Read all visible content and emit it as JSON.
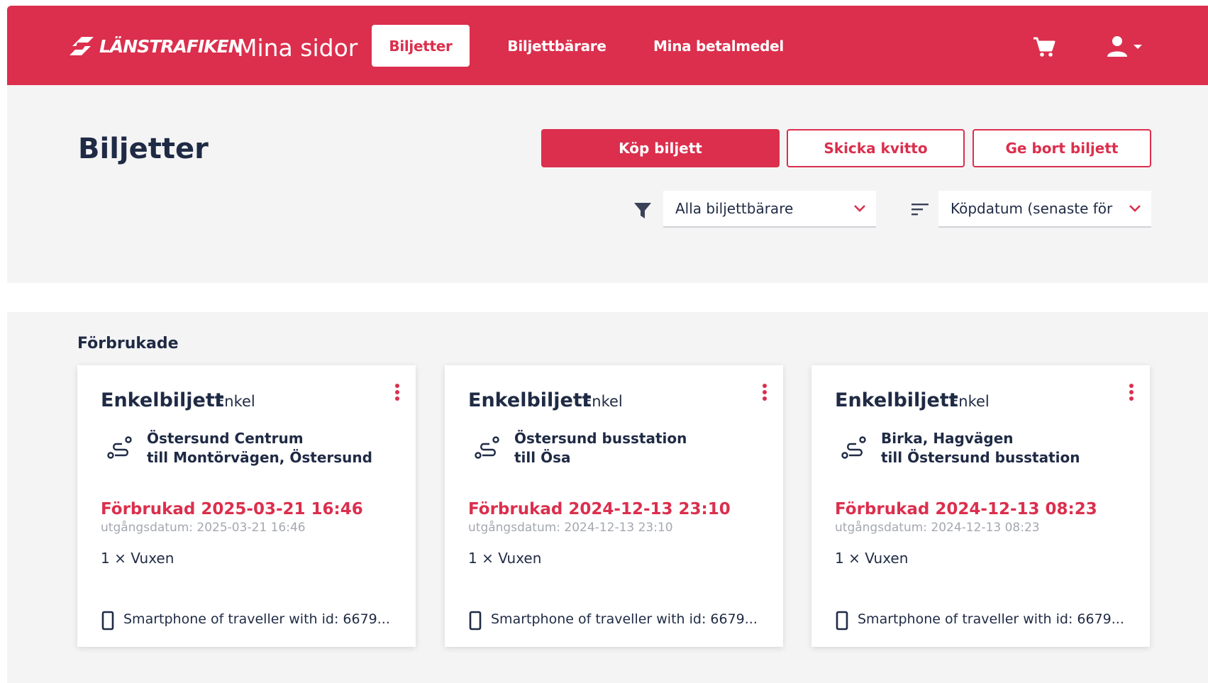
{
  "brand": {
    "logo_text": "LÄNSTRAFIKEN",
    "app_name": "Mina sidor"
  },
  "nav": {
    "tickets": "Biljetter",
    "carriers": "Biljettbärare",
    "payment": "Mina betalmedel"
  },
  "page": {
    "title": "Biljetter",
    "buy_label": "Köp biljett",
    "receipt_label": "Skicka kvitto",
    "give_label": "Ge bort biljett",
    "filter_value": "Alla biljettbärare",
    "sort_value": "Köpdatum (senaste för"
  },
  "section": {
    "title": "Förbrukade"
  },
  "tickets": [
    {
      "name": "Enkelbiljett",
      "type": "Enkel",
      "from": "Östersund Centrum",
      "to": "till Montörvägen, Östersund",
      "used": "Förbrukad 2025-03-21 16:46",
      "expiry": "utgångsdatum: 2025-03-21 16:46",
      "qty": "1 × Vuxen",
      "carrier": "Smartphone of traveller with id: 6679..."
    },
    {
      "name": "Enkelbiljett",
      "type": "Enkel",
      "from": "Östersund busstation",
      "to": "till Ösa",
      "used": "Förbrukad 2024-12-13 23:10",
      "expiry": "utgångsdatum: 2024-12-13 23:10",
      "qty": "1 × Vuxen",
      "carrier": "Smartphone of traveller with id: 6679..."
    },
    {
      "name": "Enkelbiljett",
      "type": "Enkel",
      "from": "Birka, Hagvägen",
      "to": "till Östersund busstation",
      "used": "Förbrukad 2024-12-13 08:23",
      "expiry": "utgångsdatum: 2024-12-13 08:23",
      "qty": "1 × Vuxen",
      "carrier": "Smartphone of traveller with id: 6679..."
    }
  ],
  "colors": {
    "brand_red": "#db2f4d",
    "navy": "#1f2a44",
    "muted": "#a4a8b0",
    "panel": "#f4f4f5"
  },
  "icons": [
    "logo-icon",
    "cart-icon",
    "user-icon",
    "chevron-down-icon",
    "filter-icon",
    "sort-icon",
    "kebab-icon",
    "route-icon",
    "smartphone-icon"
  ]
}
